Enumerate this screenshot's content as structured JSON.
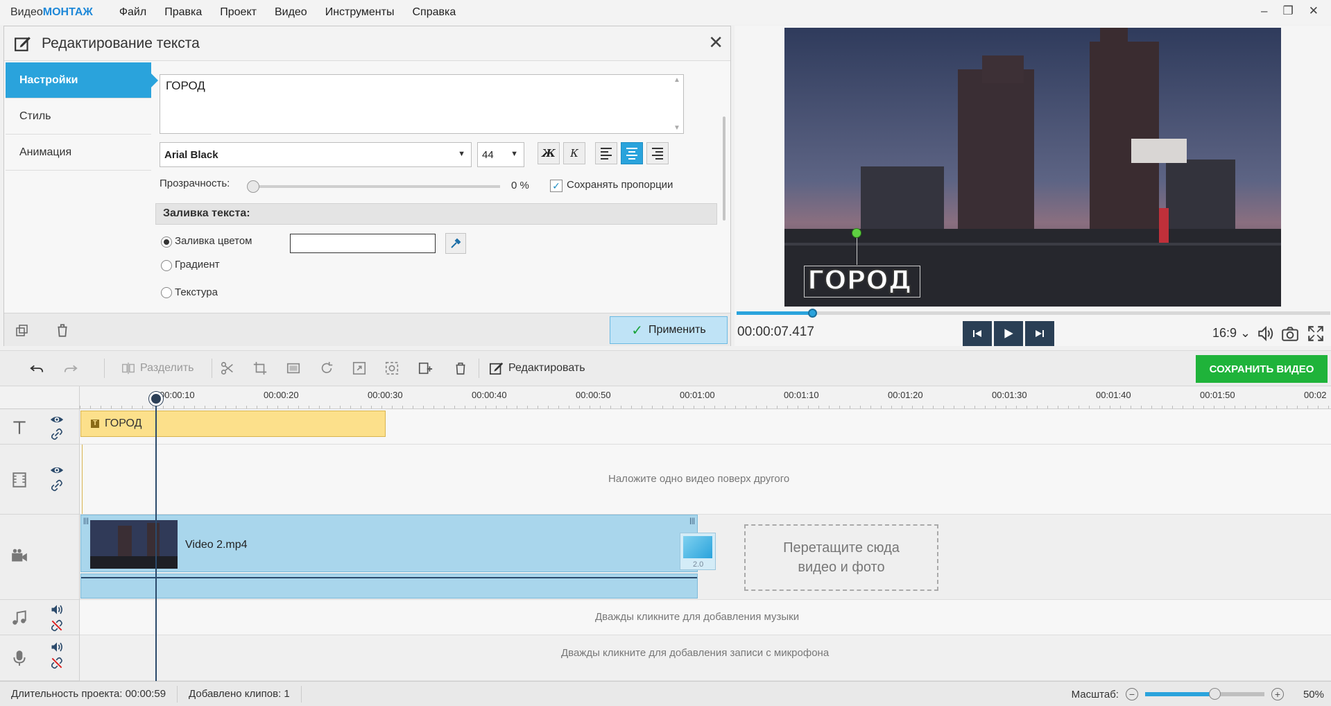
{
  "app": {
    "logo_prefix": "Видео",
    "logo_brand": "МОНТАЖ",
    "menu": [
      "Файл",
      "Правка",
      "Проект",
      "Видео",
      "Инструменты",
      "Справка"
    ]
  },
  "panel": {
    "title": "Редактирование текста",
    "tabs": [
      "Настройки",
      "Стиль",
      "Анимация"
    ],
    "text_value": "ГОРОД",
    "font": "Arial Black",
    "font_size": "44",
    "bold_label": "Ж",
    "italic_label": "К",
    "opacity_label": "Прозрачность:",
    "opacity_value": "0 %",
    "keep_ratio_label": "Сохранять пропорции",
    "fill_section": "Заливка текста:",
    "fill_options": [
      "Заливка цветом",
      "Градиент",
      "Текстура"
    ],
    "apply_label": "Применить"
  },
  "preview": {
    "overlay_text": "ГОРОД",
    "timecode": "00:00:07.417",
    "ratio": "16:9",
    "progress_fraction": 0.126
  },
  "toolbar": {
    "split_label": "Разделить",
    "edit_label": "Редактировать",
    "save_label": "СОХРАНИТЬ ВИДЕО"
  },
  "timeline": {
    "ruler_labels": [
      "00:00:10",
      "00:00:20",
      "00:00:30",
      "00:00:40",
      "00:00:50",
      "00:01:00",
      "00:01:10",
      "00:01:20",
      "00:01:30",
      "00:01:40",
      "00:01:50",
      "00:02"
    ],
    "text_clip": "ГОРОД",
    "overlay_hint": "Наложите одно видео поверх другого",
    "video_clip": "Video 2.mp4",
    "transition_label": "2.0",
    "dropzone_line1": "Перетащите сюда",
    "dropzone_line2": "видео и фото",
    "music_hint": "Дважды кликните для добавления музыки",
    "mic_hint": "Дважды кликните для добавления записи с микрофона"
  },
  "status": {
    "duration": "Длительность проекта:  00:00:59",
    "clips": "Добавлено клипов: 1",
    "zoom_label": "Масштаб:",
    "zoom_value": "50%",
    "zoom_fraction": 0.58
  },
  "colors": {
    "accent": "#2aa3dc",
    "save_green": "#1fb33a",
    "text_clip": "#fce08b",
    "video_clip": "#a9d6ec"
  }
}
